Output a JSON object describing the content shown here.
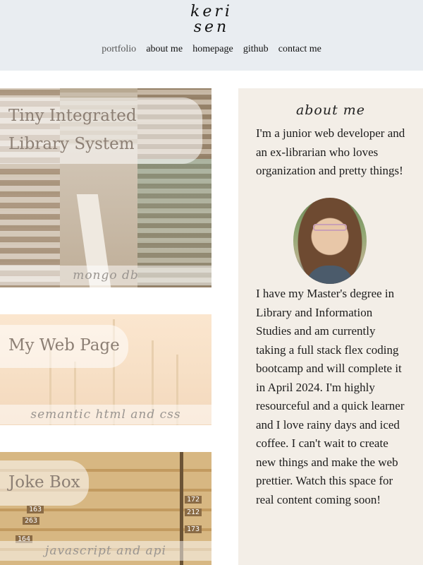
{
  "header": {
    "logo_line1": "keri",
    "logo_line2": "sen",
    "nav": [
      "portfolio",
      "about me",
      "homepage",
      "github",
      "contact me"
    ]
  },
  "projects": [
    {
      "title_line1": "Tiny Integrated",
      "title_line2": "Library System",
      "tag": "mongo db"
    },
    {
      "title": "My Web Page",
      "tag": "semantic html and css"
    },
    {
      "title": "Joke Box",
      "tag": "javascript and api"
    }
  ],
  "drawer_numbers": [
    "163",
    "263",
    "164",
    "212",
    "172",
    "173"
  ],
  "about": {
    "heading": "about me",
    "intro": "I'm a junior web developer and an ex-librarian who loves organization and pretty things!",
    "bio": "I have my Master's degree in Library and Information Studies and am currently taking a full stack flex coding bootcamp and will complete it in April 2024. I'm highly resourceful and a quick learner and I love rainy days and iced coffee. I can't wait to create new things and make the web prettier. Watch this space for real content coming soon!"
  },
  "colors": {
    "header_bg": "#e9edf1",
    "about_bg": "#f3eee7",
    "title_text": "#8c7f74"
  }
}
